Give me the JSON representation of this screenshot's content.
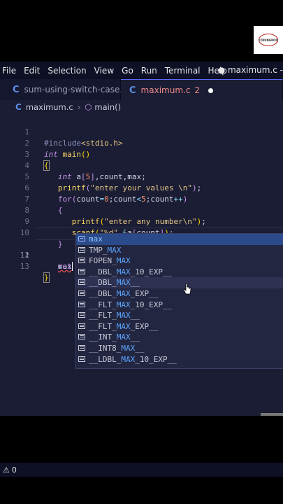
{
  "logo": {
    "text": "CODINGKOD"
  },
  "menubar": {
    "items": [
      "File",
      "Edit",
      "Selection",
      "View",
      "Go",
      "Run",
      "Terminal",
      "Help"
    ],
    "title": "● maximum.c -"
  },
  "tabs": [
    {
      "icon": "C",
      "label": "sum-using-switch-case.c"
    },
    {
      "icon": "C",
      "label": "maximum.c",
      "badge": "2"
    }
  ],
  "breadcrumb": {
    "file": "maximum.c",
    "symbol": "main()"
  },
  "code": {
    "line_numbers": [
      "1",
      "2",
      "3",
      "4",
      "5",
      "6",
      "7",
      "8",
      "9",
      "10",
      "11",
      "12",
      "13"
    ],
    "current_line": "11"
  },
  "suggestions": [
    {
      "label": "max",
      "kind": "variable"
    },
    {
      "label": "TMP_MAX",
      "kind": "text"
    },
    {
      "label": "FOPEN_MAX",
      "kind": "text"
    },
    {
      "label": "__DBL_MAX_10_EXP__",
      "kind": "text"
    },
    {
      "label": "__DBL_MAX__",
      "kind": "text"
    },
    {
      "label": "__DBL_MAX_EXP__",
      "kind": "text"
    },
    {
      "label": "__FLT_MAX_10_EXP__",
      "kind": "text"
    },
    {
      "label": "__FLT_MAX__",
      "kind": "text"
    },
    {
      "label": "__FLT_MAX_EXP__",
      "kind": "text"
    },
    {
      "label": "__INT_MAX__",
      "kind": "text"
    },
    {
      "label": "__INT8_MAX__",
      "kind": "text"
    },
    {
      "label": "__LDBL_MAX_10_EXP__",
      "kind": "text"
    }
  ],
  "statusbar": {
    "warnings": "0"
  }
}
